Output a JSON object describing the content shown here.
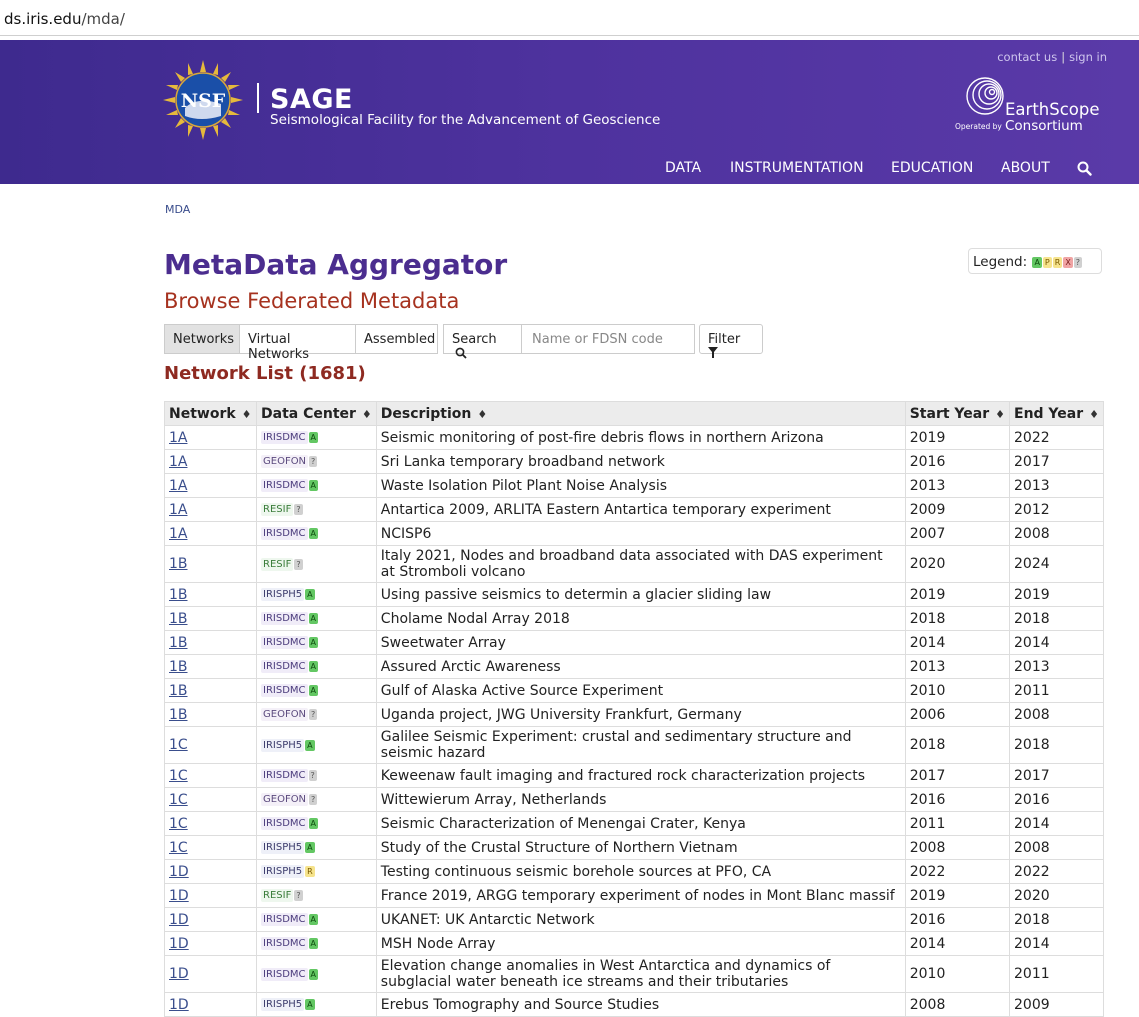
{
  "browser": {
    "url_prefix": "ds.",
    "url_domain": "iris.edu",
    "url_path": "/mda/"
  },
  "header": {
    "contact": "contact us",
    "signin": "sign in",
    "sep": "|",
    "logo_nsf": "NSF",
    "brand": "SAGE",
    "brand_sub": "Seismological Facility for the Advancement of Geoscience",
    "earthscope_1": "EarthScope",
    "earthscope_2": "Consortium",
    "earthscope_op": "Operated by",
    "nav": [
      "DATA",
      "INSTRUMENTATION",
      "EDUCATION",
      "ABOUT"
    ]
  },
  "breadcrumb": "MDA",
  "legend": {
    "label": "Legend:",
    "codes": [
      "A",
      "P",
      "R",
      "X",
      "?"
    ]
  },
  "title": "MetaData Aggregator",
  "subtitle": "Browse Federated Metadata",
  "tabs": [
    "Networks",
    "Virtual Networks",
    "Assembled"
  ],
  "search_label": "Search",
  "search_placeholder": "Name or FDSN code",
  "filter_label": "Filter",
  "list_title": "Network List (1681)",
  "columns": [
    "Network",
    "Data Center",
    "Description",
    "Start Year",
    "End Year"
  ],
  "rows": [
    {
      "net": "1A",
      "dc": "IRISDMC",
      "st": "A",
      "desc": "Seismic monitoring of post-fire debris flows in northern Arizona",
      "start": "2019",
      "end": "2022"
    },
    {
      "net": "1A",
      "dc": "GEOFON",
      "st": "?",
      "desc": "Sri Lanka temporary broadband network",
      "start": "2016",
      "end": "2017"
    },
    {
      "net": "1A",
      "dc": "IRISDMC",
      "st": "A",
      "desc": "Waste Isolation Pilot Plant Noise Analysis",
      "start": "2013",
      "end": "2013"
    },
    {
      "net": "1A",
      "dc": "RESIF",
      "st": "?",
      "desc": "Antartica 2009, ARLITA Eastern Antartica temporary experiment",
      "start": "2009",
      "end": "2012"
    },
    {
      "net": "1A",
      "dc": "IRISDMC",
      "st": "A",
      "desc": "NCISP6",
      "start": "2007",
      "end": "2008"
    },
    {
      "net": "1B",
      "dc": "RESIF",
      "st": "?",
      "desc": "Italy 2021, Nodes and broadband data associated with DAS experiment at Stromboli volcano",
      "start": "2020",
      "end": "2024"
    },
    {
      "net": "1B",
      "dc": "IRISPH5",
      "st": "A",
      "desc": "Using passive seismics to determin a glacier sliding law",
      "start": "2019",
      "end": "2019"
    },
    {
      "net": "1B",
      "dc": "IRISDMC",
      "st": "A",
      "desc": "Cholame Nodal Array 2018",
      "start": "2018",
      "end": "2018"
    },
    {
      "net": "1B",
      "dc": "IRISDMC",
      "st": "A",
      "desc": "Sweetwater Array",
      "start": "2014",
      "end": "2014"
    },
    {
      "net": "1B",
      "dc": "IRISDMC",
      "st": "A",
      "desc": "Assured Arctic Awareness",
      "start": "2013",
      "end": "2013"
    },
    {
      "net": "1B",
      "dc": "IRISDMC",
      "st": "A",
      "desc": "Gulf of Alaska Active Source Experiment",
      "start": "2010",
      "end": "2011"
    },
    {
      "net": "1B",
      "dc": "GEOFON",
      "st": "?",
      "desc": "Uganda project, JWG University Frankfurt, Germany",
      "start": "2006",
      "end": "2008"
    },
    {
      "net": "1C",
      "dc": "IRISPH5",
      "st": "A",
      "desc": "Galilee Seismic Experiment: crustal and sedimentary structure and seismic hazard",
      "start": "2018",
      "end": "2018"
    },
    {
      "net": "1C",
      "dc": "IRISDMC",
      "st": "?",
      "desc": "Keweenaw fault imaging and fractured rock characterization projects",
      "start": "2017",
      "end": "2017"
    },
    {
      "net": "1C",
      "dc": "GEOFON",
      "st": "?",
      "desc": "Wittewierum Array, Netherlands",
      "start": "2016",
      "end": "2016"
    },
    {
      "net": "1C",
      "dc": "IRISDMC",
      "st": "A",
      "desc": "Seismic Characterization of Menengai Crater, Kenya",
      "start": "2011",
      "end": "2014"
    },
    {
      "net": "1C",
      "dc": "IRISPH5",
      "st": "A",
      "desc": "Study of the Crustal Structure of Northern Vietnam",
      "start": "2008",
      "end": "2008"
    },
    {
      "net": "1D",
      "dc": "IRISPH5",
      "st": "R",
      "desc": "Testing continuous seismic borehole sources at PFO, CA",
      "start": "2022",
      "end": "2022"
    },
    {
      "net": "1D",
      "dc": "RESIF",
      "st": "?",
      "desc": "France 2019, ARGG temporary experiment of nodes in Mont Blanc massif",
      "start": "2019",
      "end": "2020"
    },
    {
      "net": "1D",
      "dc": "IRISDMC",
      "st": "A",
      "desc": "UKANET: UK Antarctic Network",
      "start": "2016",
      "end": "2018"
    },
    {
      "net": "1D",
      "dc": "IRISDMC",
      "st": "A",
      "desc": "MSH Node Array",
      "start": "2014",
      "end": "2014"
    },
    {
      "net": "1D",
      "dc": "IRISDMC",
      "st": "A",
      "desc": "Elevation change anomalies in West Antarctica and dynamics of subglacial water beneath ice streams and their tributaries",
      "start": "2010",
      "end": "2011"
    },
    {
      "net": "1D",
      "dc": "IRISPH5",
      "st": "A",
      "desc": "Erebus Tomography and Source Studies",
      "start": "2008",
      "end": "2009"
    }
  ]
}
